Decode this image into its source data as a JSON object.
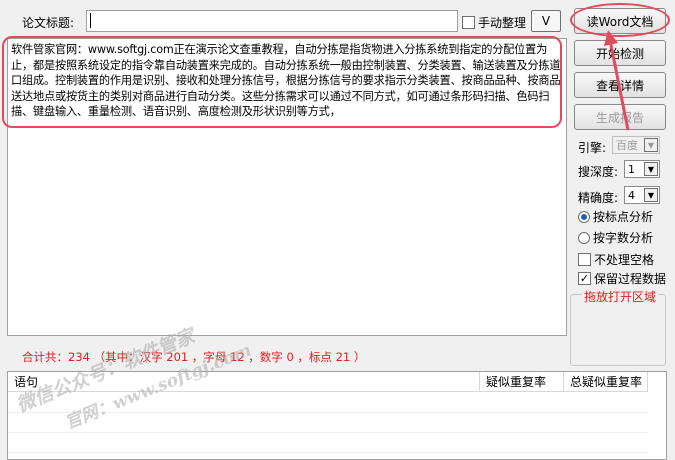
{
  "header": {
    "title_label": "论文标题:",
    "title_value": "",
    "manual_label": "手动整理",
    "manual_checked": false,
    "v_button": "V"
  },
  "buttons": {
    "read_word": "读Word文档",
    "start_check": "开始检测",
    "view_details": "查看详情",
    "generate_report": "生成报告"
  },
  "main_text": "软件管家官网：www.softgj.com正在演示论文查重教程，自动分拣是指货物进入分拣系统到指定的分配位置为止，都是按照系统设定的指令靠自动装置来完成的。自动分拣系统一般由控制装置、分类装置、输送装置及分拣道口组成。控制装置的作用是识别、接收和处理分拣信号，根据分拣信号的要求指示分类装置、按商品品种、按商品送达地点或按货主的类别对商品进行自动分类。这些分拣需求可以通过不同方式，如可通过条形码扫描、色码扫描、键盘输入、重量检测、语音识别、高度检测及形状识别等方式，",
  "settings": {
    "engine_label": "引擎:",
    "engine_value": "百度",
    "depth_label": "搜深度:",
    "depth_value": "1",
    "precision_label": "精确度:",
    "precision_value": "4",
    "radio_punct": "按标点分析",
    "radio_chars": "按字数分析",
    "radio_selected": "按标点分析",
    "no_space_label": "不处理空格",
    "no_space_checked": false,
    "keep_data_label": "保留过程数据",
    "keep_data_checked": true,
    "drop_area_title": "拖放打开区域"
  },
  "summary": "合计共：234  （其中：汉字 201 ，字母 12 ，数字 0 ，标点 21 ）",
  "table": {
    "columns": [
      "语句",
      "疑似重复率",
      "总疑似重复率"
    ]
  },
  "watermarks": {
    "w1": "微信公众号：软件管家",
    "w2": "官网：www.softgj.com"
  },
  "colors": {
    "highlight": "#e34a5d",
    "summary_red": "#e02020"
  }
}
